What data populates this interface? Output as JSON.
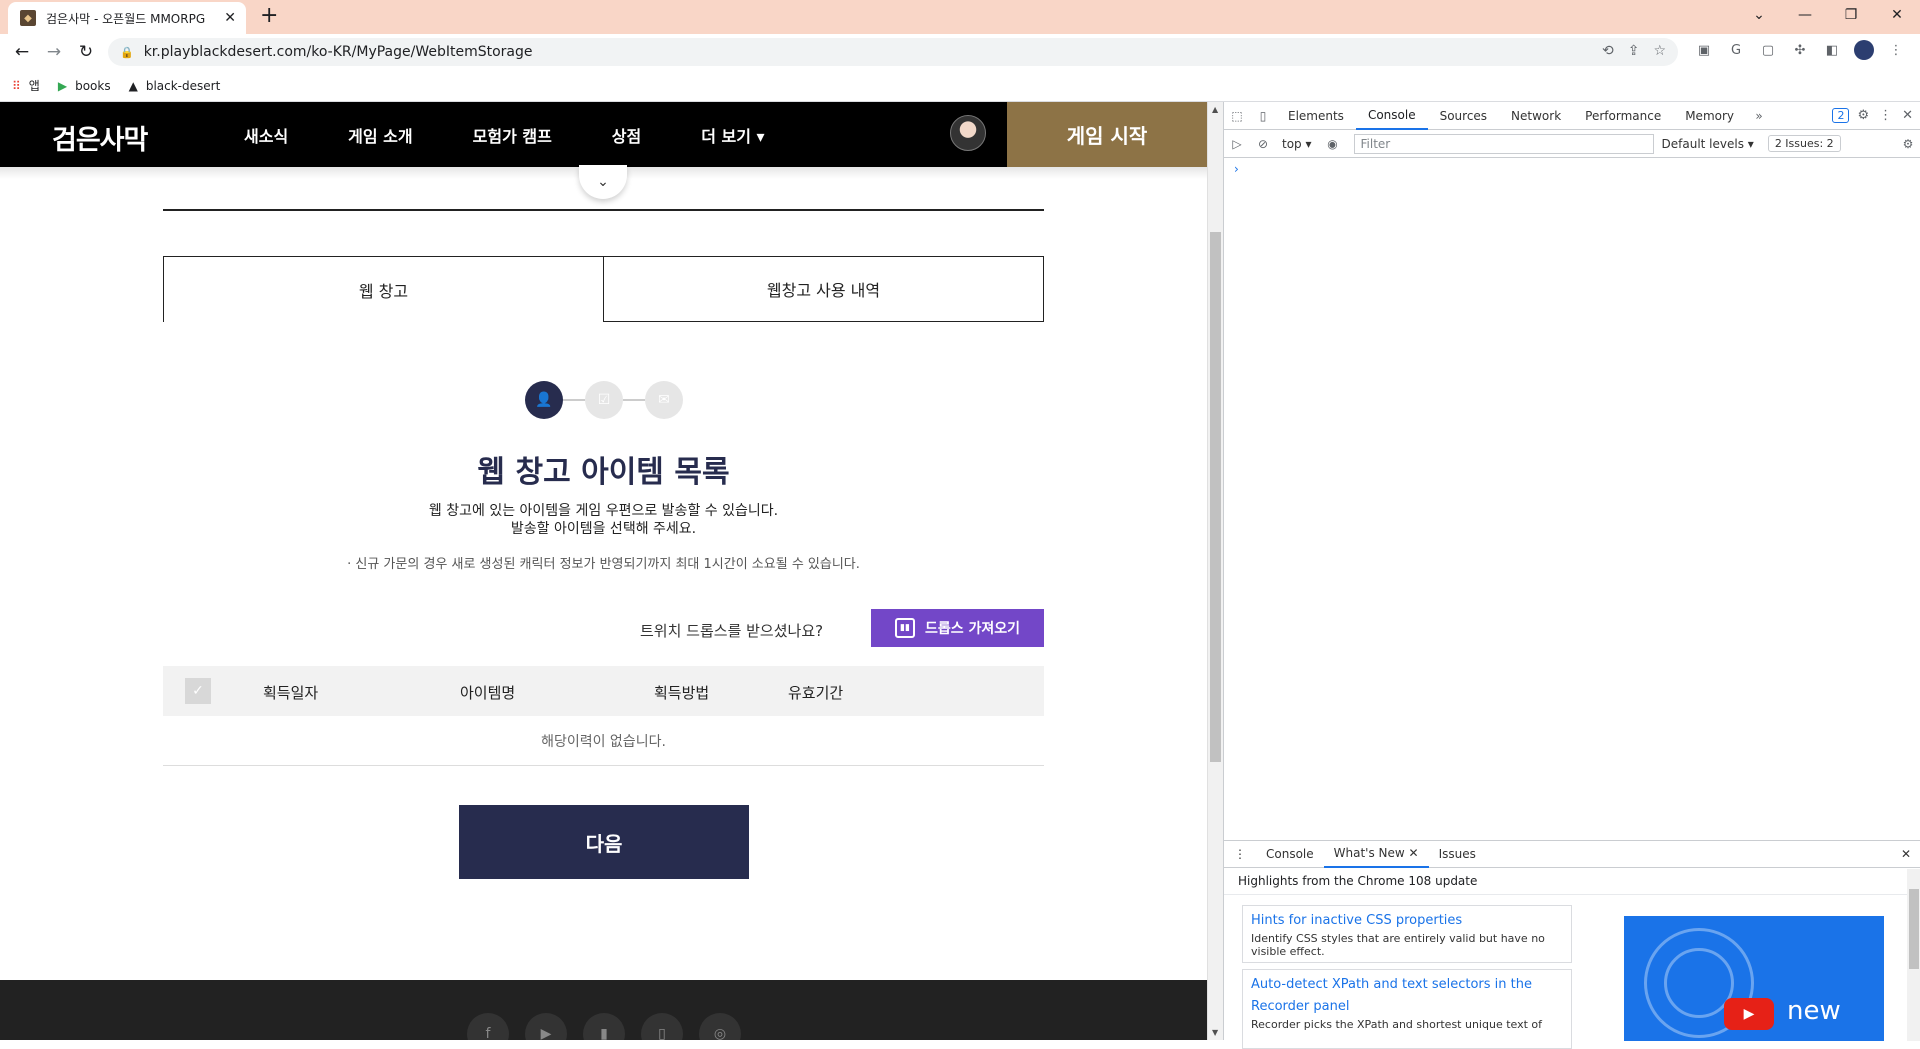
{
  "browser": {
    "tab_title": "검은사막 - 오픈월드 MMORPG",
    "url": "kr.playblackdesert.com/ko-KR/MyPage/WebItemStorage",
    "bookmarks": [
      {
        "icon": "apps-grid-icon",
        "label": "앱"
      },
      {
        "icon": "play-store-icon",
        "label": "books"
      },
      {
        "icon": "black-desert-icon",
        "label": "black-desert"
      }
    ],
    "theme_color": "#f9d6c7"
  },
  "site": {
    "logo": "검은사막",
    "nav": [
      "새소식",
      "게임 소개",
      "모험가 캠프",
      "상점",
      "더 보기 ▾"
    ],
    "start_button": "게임 시작",
    "accent_color": "#272c4e",
    "start_color": "#8d7346"
  },
  "storage": {
    "tabs": [
      "웹 창고",
      "웹창고 사용 내역"
    ],
    "title": "웹 창고 아이템 목록",
    "desc_line1": "웹 창고에 있는 아이템을 게임 우편으로 발송할 수 있습니다.",
    "desc_line2": "발송할 아이템을 선택해 주세요.",
    "notice": "· 신규 가문의 경우 새로 생성된 캐릭터 정보가 반영되기까지 최대 1시간이 소요될 수 있습니다.",
    "twitch_question": "트위치 드롭스를 받으셨나요?",
    "twitch_button": "드롭스 가져오기",
    "twitch_color": "#7347c8",
    "table_headers": [
      "획득일자",
      "아이템명",
      "획득방법",
      "유효기간"
    ],
    "empty_text": "해당이력이 없습니다.",
    "next_button": "다음"
  },
  "devtools": {
    "tabs": [
      "Elements",
      "Console",
      "Sources",
      "Network",
      "Performance",
      "Memory"
    ],
    "active_tab": "Console",
    "issues_badge": "2",
    "context": "top ▾",
    "filter_placeholder": "Filter",
    "levels": "Default levels ▾",
    "issues_label": "2 Issues: 2",
    "drawer_tabs": [
      "Console",
      "What's New",
      "Issues"
    ],
    "highlights": "Highlights from the Chrome 108 update",
    "cards": [
      {
        "title": "Hints for inactive CSS properties",
        "desc": "Identify CSS styles that are entirely valid but have no visible effect."
      },
      {
        "title": "Auto-detect XPath and text selectors in the Recorder panel",
        "desc": "Recorder picks the XPath and shortest unique text of"
      }
    ],
    "video_label": "new"
  }
}
